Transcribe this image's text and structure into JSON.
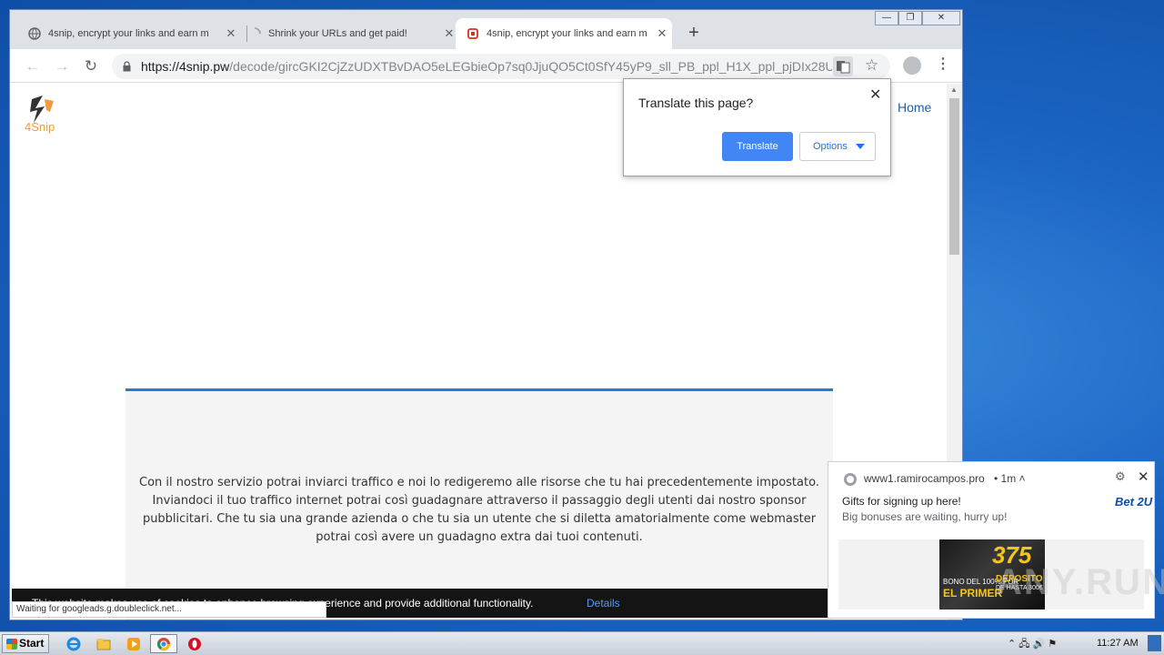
{
  "window": {
    "tabs": [
      {
        "title": "4snip, encrypt your links and earn m",
        "close": "✕"
      },
      {
        "title": "Shrink your URLs and get paid!",
        "close": "✕"
      },
      {
        "title": "4snip, encrypt your links and earn m",
        "close": "✕"
      }
    ],
    "new_tab": "+",
    "controls": {
      "minimize": "—",
      "restore": "❐",
      "close": "✕"
    }
  },
  "toolbar": {
    "back": "←",
    "forward": "→",
    "reload": "↻",
    "url_host": "https://4snip.pw",
    "url_path": "/decode/gircGKI2CjZzUDXTBvDAO5eLEGbieOp7sq0JjuQO5Ct0SfY45yP9_sll_PB_ppl_H1X_ppl_pjDIx28U...",
    "star": "☆",
    "menu": "⋮"
  },
  "page": {
    "logo_text": "4Snip",
    "home_link": "Home",
    "content_text": "Con il nostro servizio potrai inviarci traffico e noi lo redigeremo alle risorse che tu hai precedentemente impostato. Inviandoci il tuo traffico internet potrai così guadagnare attraverso il passaggio degli utenti dai nostro sponsor pubblicitari. Che tu sia una grande azienda o che tu sia un utente che si diletta amatorialmente come webmaster potrai così avere un guadagno extra dai tuoi contenuti.",
    "cookie_text": "This website makes use of cookies to enhance browsing experience and provide additional functionality.",
    "cookie_details": "Details",
    "status_text": "Waiting for googleads.g.doubleclick.net..."
  },
  "translate_popup": {
    "title": "Translate this page?",
    "translate_button": "Translate",
    "options_button": "Options",
    "close": "✕"
  },
  "notification": {
    "origin": "www1.ramirocampos.pro",
    "time": "• 1m ˄",
    "title": "Gifts for signing up here!",
    "body": "Big bonuses are waiting, hurry up!",
    "brand": "Bet 2U",
    "ad_big": "375",
    "ad_line1": "BONO DEL 100% POR",
    "ad_line2": "EL PRIMER",
    "ad_line3": "DEPOSITO",
    "ad_line4": "DE HASTA 300€",
    "gear": "⚙",
    "close": "✕"
  },
  "watermark": "ANY.RUN",
  "taskbar": {
    "start_label": "Start",
    "clock": "11:27 AM",
    "tray_icons": "⌃ 🖧 🔊 ⚑"
  },
  "colors": {
    "accent_blue": "#4285f4",
    "content_border": "#2b7bd5",
    "logo_orange": "#f39c3d"
  }
}
